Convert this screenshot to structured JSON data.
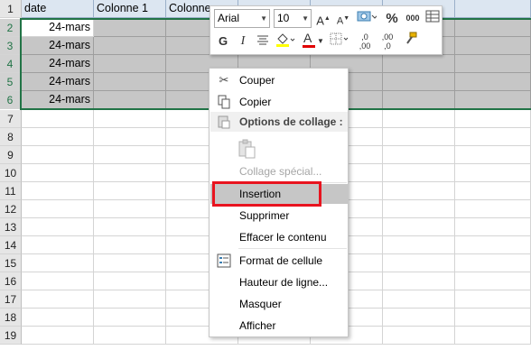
{
  "grid": {
    "row_numbers": [
      "1",
      "2",
      "3",
      "4",
      "5",
      "6",
      "7",
      "8",
      "9",
      "10",
      "11",
      "12",
      "13",
      "14",
      "15",
      "16",
      "17",
      "18",
      "19"
    ],
    "header_row": [
      "date",
      "Colonne 1",
      "Colonne"
    ],
    "dates": [
      "24-mars",
      "24-mars",
      "24-mars",
      "24-mars",
      "24-mars"
    ]
  },
  "mini_toolbar": {
    "font_name": "Arial",
    "font_size": "10",
    "grow_font": "A",
    "shrink_font": "A",
    "percent": "%",
    "thousands": "000",
    "bold": "G",
    "italic": "I",
    "font_color_letter": "A",
    "dec_increase": ",0 ,00",
    "dec_decrease": ",00 ,0",
    "icons": [
      "increase-font-icon",
      "decrease-font-icon",
      "accounting-format-icon",
      "percent-icon",
      "thousands-separator-icon",
      "format-table-icon",
      "bold-icon",
      "italic-icon",
      "align-center-icon",
      "fill-color-icon",
      "font-color-icon",
      "borders-icon",
      "increase-decimal-icon",
      "decrease-decimal-icon",
      "format-painter-icon"
    ]
  },
  "context_menu": {
    "items": [
      {
        "label": "Couper",
        "icon": "scissors-icon"
      },
      {
        "label": "Copier",
        "icon": "copy-icon"
      },
      {
        "label": "Options de collage :",
        "icon": "paste-options-icon"
      },
      {
        "label": "",
        "icon": "paste-icon"
      },
      {
        "label": "Collage spécial...",
        "icon": ""
      },
      {
        "label": "Insertion",
        "icon": ""
      },
      {
        "label": "Supprimer",
        "icon": ""
      },
      {
        "label": "Effacer le contenu",
        "icon": ""
      },
      {
        "label": "Format de cellule",
        "icon": "format-cells-icon"
      },
      {
        "label": "Hauteur de ligne...",
        "icon": ""
      },
      {
        "label": "Masquer",
        "icon": ""
      },
      {
        "label": "Afficher",
        "icon": ""
      }
    ]
  },
  "colors": {
    "selection_green": "#217346",
    "highlight_red": "#e8141f",
    "header_blue": "#dce6f1",
    "selected_gray": "#c6c6c6"
  }
}
